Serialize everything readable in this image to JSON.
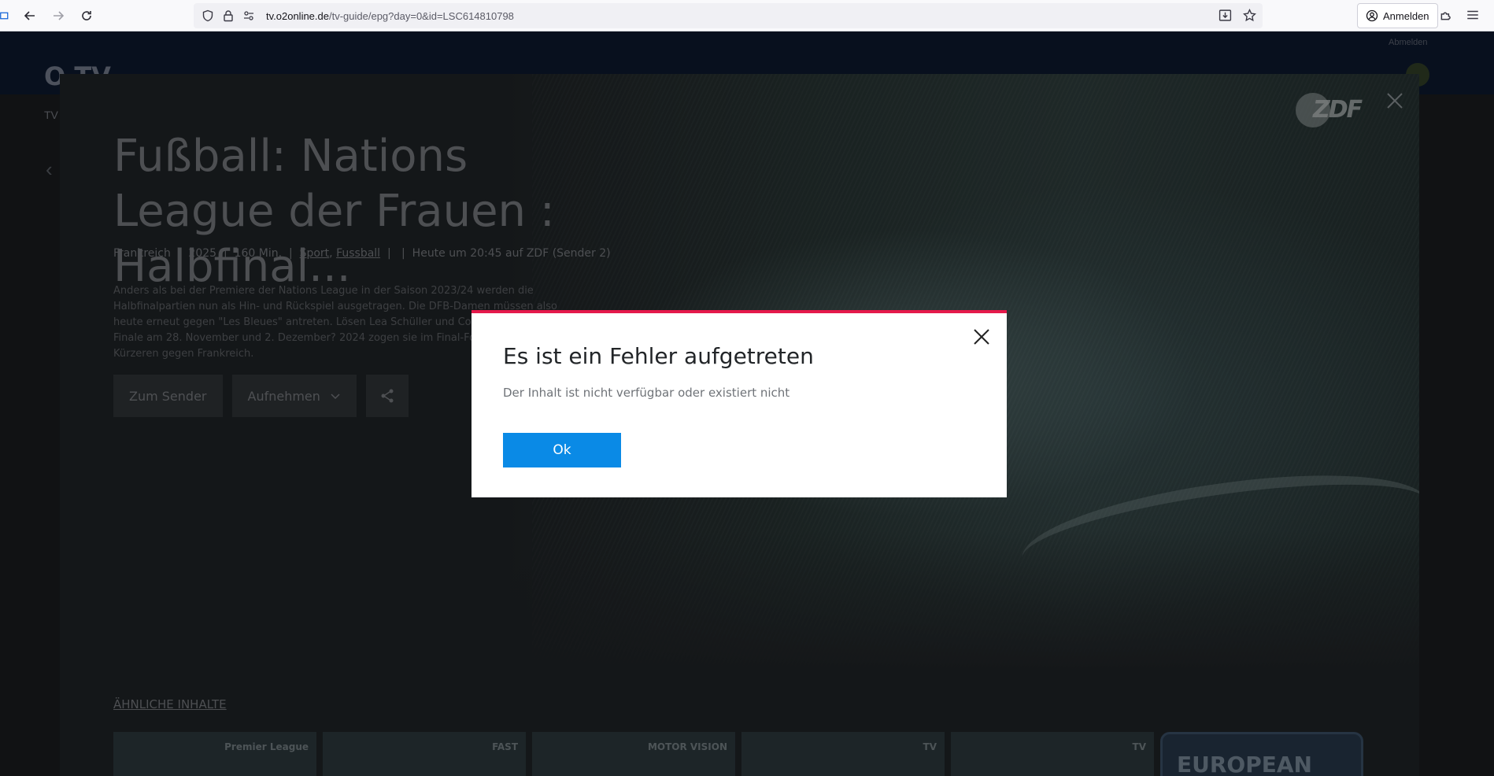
{
  "browser": {
    "url_host": "tv.o2online.de",
    "url_path": "/tv-guide/epg?day=0&id=LSC614810798",
    "signin_label": "Anmelden"
  },
  "site": {
    "logo": "O TV",
    "side_label": "TV",
    "logout_label": "Abmelden"
  },
  "detail": {
    "title": "Fußball: Nations League der Frauen : Halbfinal...",
    "meta": {
      "country": "Frankreich",
      "year": "2025",
      "duration": "160 Min.",
      "genre1": "Sport",
      "genre2": "Fussball",
      "airing": "Heute um 20:45 auf ZDF (Sender 2)"
    },
    "description": "Anders als bei der Premiere der Nations League in der Saison 2023/24 werden die Halbfinalpartien nun als Hin- und Rückspiel ausgetragen. Die DFB-Damen müssen also heute erneut gegen \"Les Bleues\" antreten. Lösen Lea Schüller und Co. das Ticket für das Finale am 28. November und 2. Dezember? 2024 zogen sie im Final-Four noch den Kürzeren gegen Frankreich.",
    "actions": {
      "to_channel": "Zum Sender",
      "record": "Aufnehmen"
    },
    "channel_logo": "ZDF",
    "similar_title": "ÄHNLICHE INHALTE",
    "tiles": [
      {
        "tag": "Premier League"
      },
      {
        "tag": "FAST"
      },
      {
        "tag": "MOTOR VISION"
      },
      {
        "tag": "TV"
      },
      {
        "tag": "TV"
      },
      {
        "tag": "EUROPEAN"
      }
    ]
  },
  "modal": {
    "title": "Es ist ein Fehler aufgetreten",
    "message": "Der Inhalt ist nicht verfügbar oder existiert nicht",
    "ok_label": "Ok",
    "accent_color": "#e5194b",
    "button_color": "#0a8ae6"
  }
}
